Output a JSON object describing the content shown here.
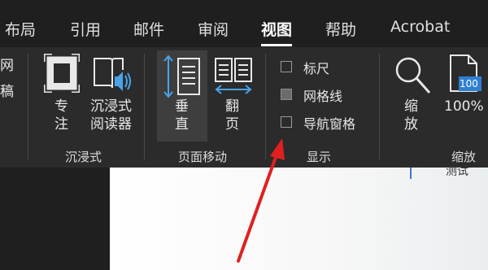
{
  "tabs": {
    "layout": "布局",
    "references": "引用",
    "mailings": "邮件",
    "review": "审阅",
    "view": "视图",
    "help": "帮助",
    "acrobat": "Acrobat"
  },
  "ribbon": {
    "left_partial": [
      "网",
      "稿"
    ],
    "immersive": {
      "focus_label": [
        "专",
        "注"
      ],
      "reader_label": [
        "沉浸式",
        "阅读器"
      ],
      "group_label": "沉浸式"
    },
    "page_movement": {
      "vertical_label": [
        "垂",
        "直"
      ],
      "side_label": [
        "翻",
        "页"
      ],
      "group_label": "页面移动"
    },
    "show": {
      "ruler": "标尺",
      "gridlines": "网格线",
      "navigation_pane": "导航窗格",
      "group_label": "显示"
    },
    "zoom": {
      "zoom_label": [
        "缩",
        "放"
      ],
      "percent_label": "100%",
      "icon_badge": "100",
      "group_label": "缩放"
    }
  },
  "document": {
    "partial_text": "测试"
  },
  "colors": {
    "accent": "#4aa3e8",
    "annotation_arrow": "#e02020"
  }
}
